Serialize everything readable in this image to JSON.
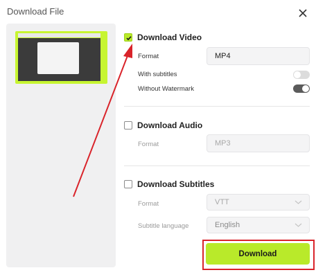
{
  "window": {
    "title": "Download File"
  },
  "video": {
    "label": "Download Video",
    "checked": true,
    "format_label": "Format",
    "format_value": "MP4",
    "subtitles_label": "With subtitles",
    "subtitles_on": false,
    "watermark_label": "Without Watermark",
    "watermark_on": true
  },
  "audio": {
    "label": "Download Audio",
    "checked": false,
    "format_label": "Format",
    "format_value": "MP3"
  },
  "subtitles": {
    "label": "Download Subtitles",
    "checked": false,
    "format_label": "Format",
    "format_value": "VTT",
    "language_label": "Subtitle language",
    "language_value": "English"
  },
  "actions": {
    "download_label": "Download"
  },
  "colors": {
    "accent": "#b9ea2a",
    "annotation": "#d9232a",
    "toggle_on": "#5b5b5b",
    "toggle_off": "#dcdcdc"
  },
  "icons": {
    "close": "close-icon",
    "check": "check-icon",
    "chevron": "chevron-down-icon"
  }
}
